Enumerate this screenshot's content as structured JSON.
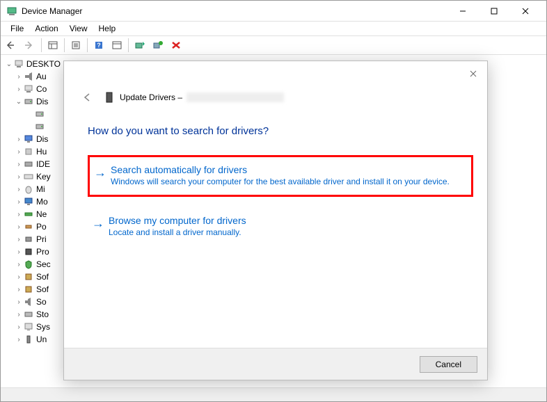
{
  "window": {
    "title": "Device Manager",
    "minimize": "−",
    "maximize": "☐",
    "close": "✕"
  },
  "menubar": {
    "file": "File",
    "action": "Action",
    "view": "View",
    "help": "Help"
  },
  "tree": {
    "root": "DESKTO",
    "items": [
      {
        "label": "Au",
        "icon": "audio"
      },
      {
        "label": "Co",
        "icon": "computer"
      },
      {
        "label": "Dis",
        "icon": "disk",
        "expanded": true,
        "children": [
          "",
          ""
        ]
      },
      {
        "label": "Dis",
        "icon": "display"
      },
      {
        "label": "Hu",
        "icon": "hid"
      },
      {
        "label": "IDE",
        "icon": "ide"
      },
      {
        "label": "Key",
        "icon": "keyboard"
      },
      {
        "label": "Mi",
        "icon": "mouse"
      },
      {
        "label": "Mo",
        "icon": "monitor"
      },
      {
        "label": "Ne",
        "icon": "network"
      },
      {
        "label": "Po",
        "icon": "port"
      },
      {
        "label": "Pri",
        "icon": "printer"
      },
      {
        "label": "Pro",
        "icon": "processor"
      },
      {
        "label": "Sec",
        "icon": "security"
      },
      {
        "label": "Sof",
        "icon": "software"
      },
      {
        "label": "Sof",
        "icon": "software"
      },
      {
        "label": "So",
        "icon": "sound"
      },
      {
        "label": "Sto",
        "icon": "storage"
      },
      {
        "label": "Sys",
        "icon": "system"
      },
      {
        "label": "Un",
        "icon": "usb"
      }
    ]
  },
  "dialog": {
    "header_prefix": "Update Drivers –",
    "question": "How do you want to search for drivers?",
    "option1": {
      "title": "Search automatically for drivers",
      "desc": "Windows will search your computer for the best available driver and install it on your device."
    },
    "option2": {
      "title": "Browse my computer for drivers",
      "desc": "Locate and install a driver manually."
    },
    "cancel": "Cancel"
  }
}
